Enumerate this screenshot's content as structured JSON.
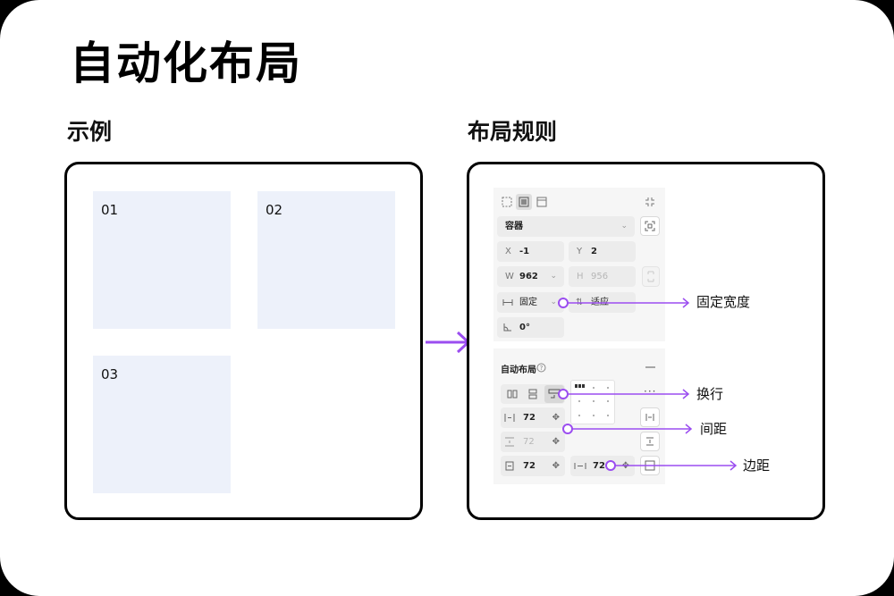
{
  "title": "自动化布局",
  "left_section": {
    "label": "示例",
    "items": [
      "01",
      "02",
      "03"
    ]
  },
  "right_section": {
    "label": "布局规则"
  },
  "panel": {
    "container_select": "容器",
    "x_label": "X",
    "x_value": "-1",
    "y_label": "Y",
    "y_value": "2",
    "w_label": "W",
    "w_value": "962",
    "h_label": "H",
    "h_value": "956",
    "width_mode": "固定",
    "height_mode": "适应",
    "rotation": "0°",
    "auto_layout_title": "自动布局",
    "gap_horizontal": "72",
    "gap_vertical": "72",
    "padding_vertical": "72",
    "padding_horizontal": "72"
  },
  "callouts": {
    "fixed_width": "固定宽度",
    "wrap": "换行",
    "spacing": "间距",
    "padding": "边距"
  },
  "colors": {
    "accent": "#9b4df0",
    "item_fill": "#edf1fa",
    "panel_bg": "#f6f6f6",
    "field_bg": "#ececec"
  }
}
